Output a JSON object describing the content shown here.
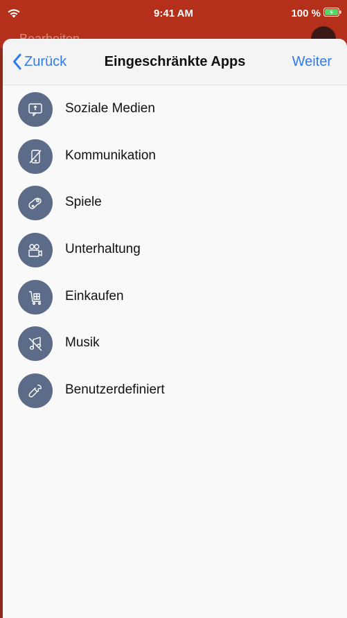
{
  "status_bar": {
    "time": "9:41 AM",
    "battery": "100 %"
  },
  "parent": {
    "title": "Bearbeiten"
  },
  "nav": {
    "back_label": "Zurück",
    "title": "Eingeschränkte Apps",
    "next_label": "Weiter"
  },
  "categories": [
    {
      "label": "Soziale Medien",
      "icon": "chat-bubble-icon"
    },
    {
      "label": "Kommunikation",
      "icon": "phone-icon"
    },
    {
      "label": "Spiele",
      "icon": "gamepad-icon"
    },
    {
      "label": "Unterhaltung",
      "icon": "video-camera-icon"
    },
    {
      "label": "Einkaufen",
      "icon": "cart-icon"
    },
    {
      "label": "Musik",
      "icon": "music-icon"
    },
    {
      "label": "Benutzerdefiniert",
      "icon": "wrench-icon"
    }
  ],
  "colors": {
    "accent": "#2f7bf2",
    "icon_bg": "#5c6b87",
    "header_bg": "#b5301a"
  }
}
